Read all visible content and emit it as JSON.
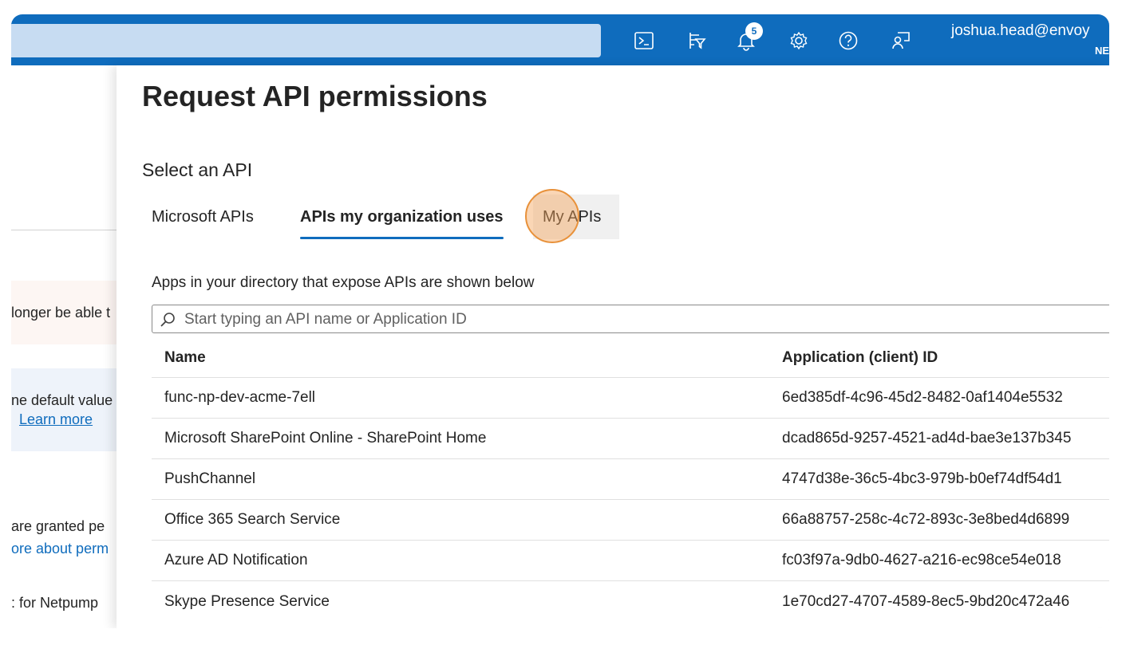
{
  "topbar": {
    "notification_count": "5",
    "user_email": "joshua.head@envoy",
    "tenant": "NE",
    "icons": [
      "cloud-shell-icon",
      "directory-filter-icon",
      "notification-icon",
      "settings-icon",
      "help-icon",
      "feedback-icon"
    ],
    "accent_color": "#0f6cbd"
  },
  "background": {
    "line1": "longer be able t",
    "line2": "ne default value",
    "line3": "Learn more",
    "line4": "are granted pe",
    "line5": "ore about perm",
    "line6": ": for Netpump"
  },
  "panel": {
    "title": "Request API permissions",
    "select_label": "Select an API",
    "tabs": [
      {
        "label": "Microsoft APIs"
      },
      {
        "label": "APIs my organization uses"
      },
      {
        "label": "My APIs"
      }
    ],
    "subtitle": "Apps in your directory that expose APIs are shown below",
    "search_placeholder": "Start typing an API name or Application ID",
    "table": {
      "headers": [
        "Name",
        "Application (client) ID"
      ],
      "rows": [
        {
          "name": "func-np-dev-acme-7ell",
          "id": "6ed385df-4c96-45d2-8482-0af1404e5532"
        },
        {
          "name": "Microsoft SharePoint Online - SharePoint Home",
          "id": "dcad865d-9257-4521-ad4d-bae3e137b345"
        },
        {
          "name": "PushChannel",
          "id": "4747d38e-36c5-4bc3-979b-b0ef74df54d1"
        },
        {
          "name": "Office 365 Search Service",
          "id": "66a88757-258c-4c72-893c-3e8bed4d6899"
        },
        {
          "name": "Azure AD Notification",
          "id": "fc03f97a-9db0-4627-a216-ec98ce54e018"
        },
        {
          "name": "Skype Presence Service",
          "id": "1e70cd27-4707-4589-8ec5-9bd20c472a46"
        }
      ]
    }
  }
}
